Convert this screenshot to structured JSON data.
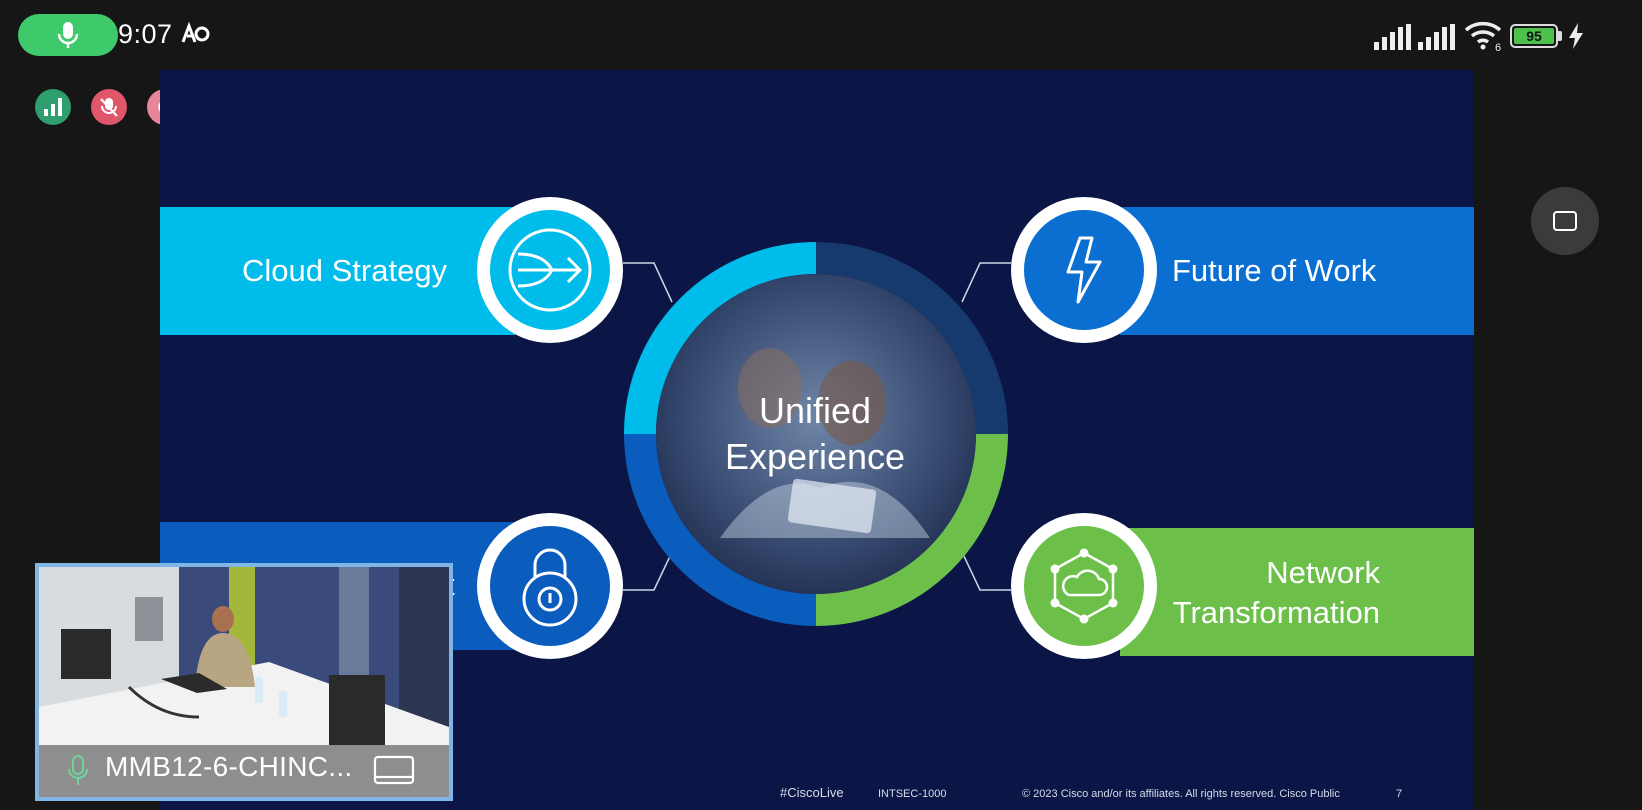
{
  "status_bar": {
    "time": "9:07",
    "battery_level": "95",
    "mic_icon": "microphone-icon",
    "icons": [
      "signal-bars-icon",
      "signal-bars-icon",
      "wifi-6-icon",
      "battery-icon",
      "charging-bolt-icon"
    ]
  },
  "meeting_indicators": {
    "icons": [
      "network-quality-icon",
      "muted-speaker-icon",
      "recording-icon"
    ],
    "colors": {
      "network": "#2e9e6e",
      "muted": "#e0566b",
      "recording": "#e7869a"
    }
  },
  "slide": {
    "background": "#0b1647",
    "center": {
      "title": "Unified\nExperience"
    },
    "pillars": [
      {
        "label": "Cloud Strategy",
        "icon": "arrow-circle-icon",
        "color": "#00bceb"
      },
      {
        "label": "Future of Work",
        "icon": "lightning-bolt-icon",
        "color": "#0a6fd1"
      },
      {
        "label": "t",
        "icon": "padlock-icon",
        "color": "#0a5cbd"
      },
      {
        "label": "Network\nTransformation",
        "icon": "cloud-network-icon",
        "color": "#6cc04a"
      }
    ],
    "footer": {
      "hashtag": "#CiscoLive",
      "session": "INTSEC-1000",
      "copyright": "© 2023  Cisco and/or its affiliates. All rights reserved.   Cisco Public",
      "page": "7"
    }
  },
  "self_view": {
    "name": "MMB12-6-CHINC...",
    "mic_icon": "microphone-icon",
    "screen_icon": "screen-share-icon"
  },
  "controls": {
    "recents_icon": "recent-apps-icon"
  }
}
